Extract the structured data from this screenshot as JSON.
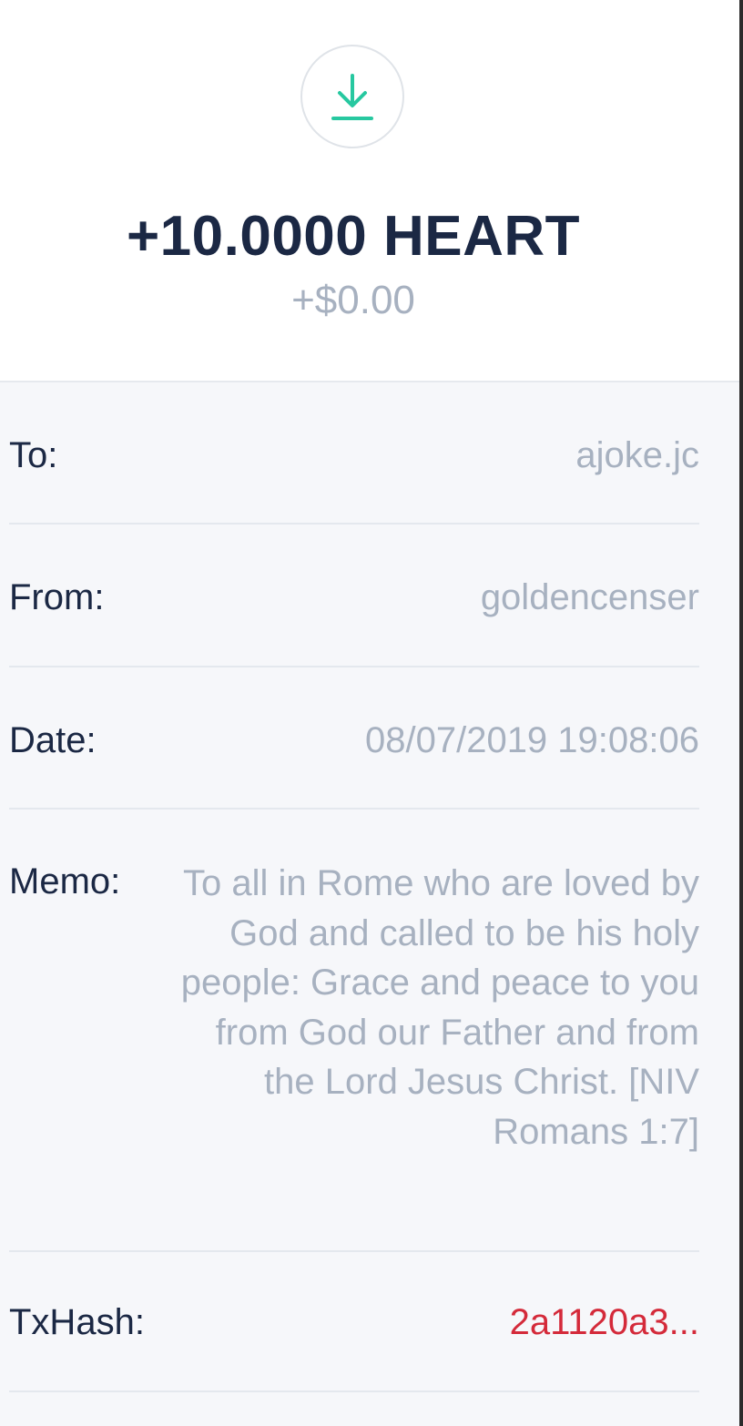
{
  "transaction": {
    "amount": "+10.0000 HEART",
    "fiat_amount": "+$0.00"
  },
  "details": {
    "to_label": "To:",
    "to_value": "ajoke.jc",
    "from_label": "From:",
    "from_value": "goldencenser",
    "date_label": "Date:",
    "date_value": "08/07/2019 19:08:06",
    "memo_label": "Memo:",
    "memo_value": "To all in Rome who are loved by God and called to be his holy people: Grace and peace to you from God our Father and from the Lord Jesus Christ. [NIV Romans 1:7]",
    "txhash_label": "TxHash:",
    "txhash_value": "2a1120a3..."
  },
  "icons": {
    "receive": "download-icon"
  },
  "colors": {
    "accent": "#27c8a0",
    "title": "#1b2844",
    "muted": "#a7b1c0",
    "hash": "#d42a3a",
    "panel": "#f6f7fa"
  }
}
